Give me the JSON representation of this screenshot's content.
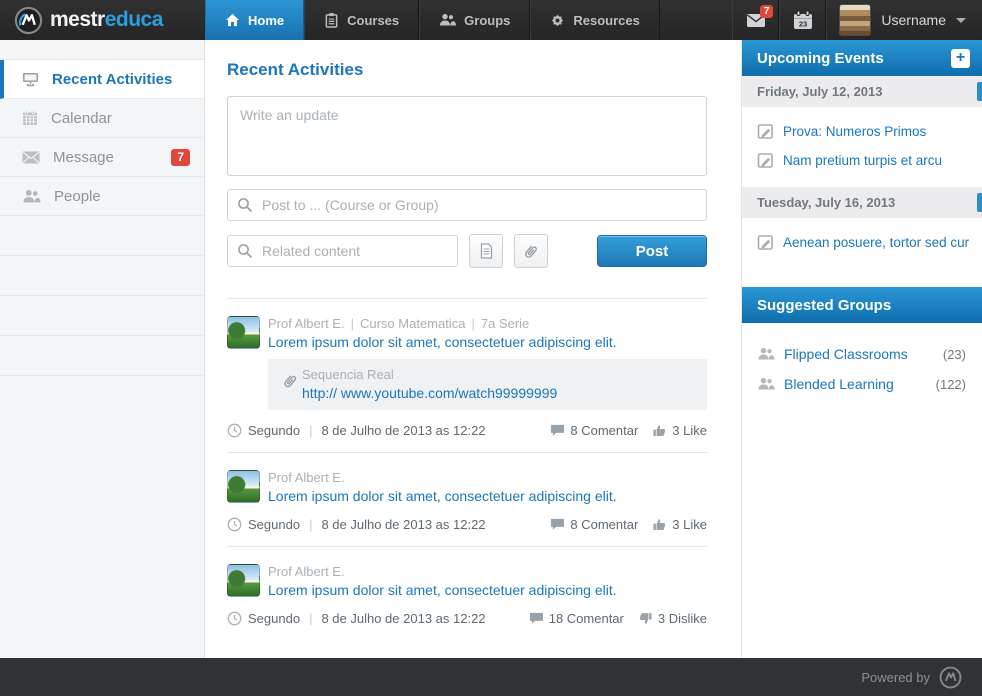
{
  "colors": {
    "accent": "#1b76bd",
    "nav_active_top": "#2d95d4",
    "nav_active_bottom": "#1971b1",
    "badge_red": "#e0483d",
    "panel_header_top": "#2b97d6",
    "panel_header_bottom": "#0f6dac"
  },
  "navbar": {
    "brand_first": "mestr",
    "brand_second": "educa",
    "tabs": [
      {
        "label": "Home"
      },
      {
        "label": "Courses"
      },
      {
        "label": "Groups"
      },
      {
        "label": "Resources"
      }
    ],
    "message_badge": "7",
    "calendar_day": "23",
    "username": "Username"
  },
  "sidebar": {
    "items": [
      {
        "label": "Recent Activities"
      },
      {
        "label": "Calendar"
      },
      {
        "label": "Message",
        "badge": "7"
      },
      {
        "label": "People"
      }
    ]
  },
  "main": {
    "title": "Recent Activities",
    "separator": "|",
    "composer": {
      "update_placeholder": "Write an update",
      "post_to_placeholder": "Post to ... (Course or Group)",
      "related_placeholder": "Related content",
      "post_label": "Post"
    },
    "feed": [
      {
        "author": "Prof Albert E.",
        "course": "Curso Matematica",
        "serie": "7a Serie",
        "title": "Lorem ipsum dolor sit amet, consectetuer adipiscing elit.",
        "attachment_name": "Sequencia Real",
        "attachment_url": "http:// www.youtube.com/watch99999999",
        "time_label": "Segundo",
        "date": "8 de Julho de 2013 as 12:22",
        "comments": "8 Comentar",
        "votes": "3 Like"
      },
      {
        "author": "Prof Albert E.",
        "title": "Lorem ipsum dolor sit amet, consectetuer adipiscing elit.",
        "time_label": "Segundo",
        "date": "8 de Julho de 2013 as 12:22",
        "comments": "8 Comentar",
        "votes": "3 Like"
      },
      {
        "author": "Prof Albert E.",
        "title": "Lorem ipsum dolor sit amet, consectetuer adipiscing elit.",
        "time_label": "Segundo",
        "date": "8 de Julho de 2013 as 12:22",
        "comments": "18 Comentar",
        "votes": "3 Dislike"
      }
    ]
  },
  "right": {
    "events_title": "Upcoming Events",
    "add_label": "+",
    "event_groups": [
      {
        "date": "Friday, July 12, 2013",
        "events": [
          "Prova: Numeros Primos",
          "Nam pretium turpis et arcu"
        ]
      },
      {
        "date": "Tuesday, July 16, 2013",
        "events": [
          "Aenean posuere, tortor sed cur"
        ]
      }
    ],
    "groups_title": "Suggested Groups",
    "groups": [
      {
        "name": "Flipped Classrooms",
        "count": "(23)"
      },
      {
        "name": "Blended Learning",
        "count": "(122)"
      }
    ]
  },
  "footer": {
    "powered_by": "Powered by"
  }
}
